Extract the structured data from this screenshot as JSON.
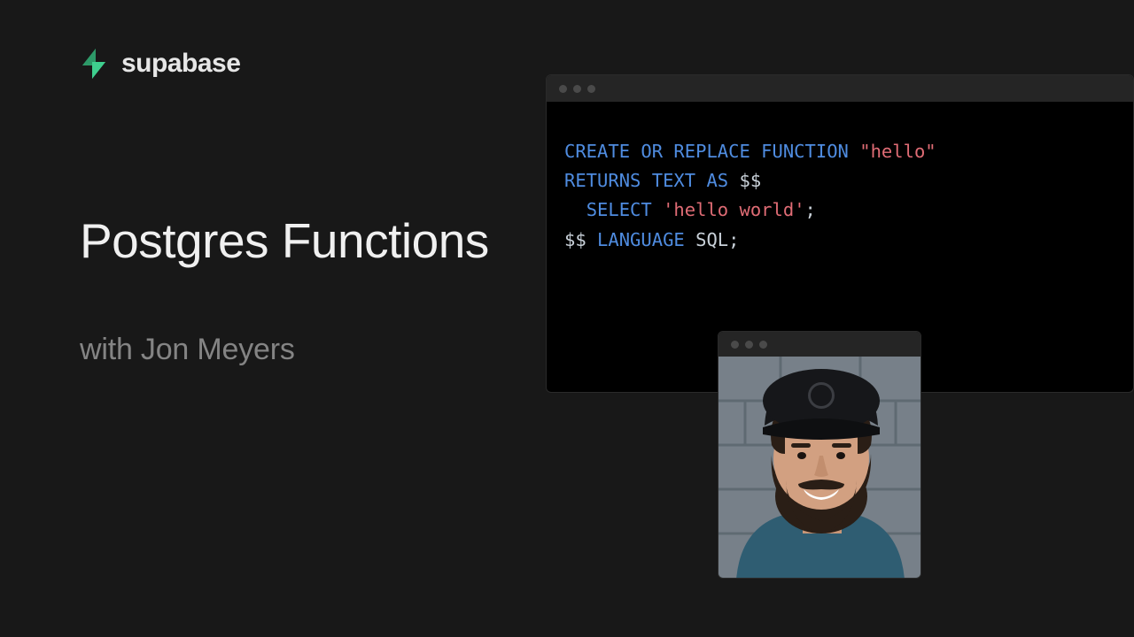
{
  "brand": {
    "name": "supabase",
    "logo_color": "#3ecf8e"
  },
  "title": "Postgres Functions",
  "subtitle": "with Jon Meyers",
  "code": {
    "tokens": [
      [
        {
          "c": "tok-kw",
          "t": "CREATE OR REPLACE FUNCTION"
        },
        {
          "c": "tok-punc",
          "t": " "
        },
        {
          "c": "tok-str",
          "t": "\"hello\""
        }
      ],
      [
        {
          "c": "tok-kw",
          "t": "RETURNS TEXT AS"
        },
        {
          "c": "tok-punc",
          "t": " "
        },
        {
          "c": "tok-dol",
          "t": "$$"
        }
      ],
      [
        {
          "c": "tok-punc",
          "t": "  "
        },
        {
          "c": "tok-kw",
          "t": "SELECT"
        },
        {
          "c": "tok-punc",
          "t": " "
        },
        {
          "c": "tok-str",
          "t": "'hello world'"
        },
        {
          "c": "tok-punc",
          "t": ";"
        }
      ],
      [
        {
          "c": "tok-dol",
          "t": "$$"
        },
        {
          "c": "tok-punc",
          "t": " "
        },
        {
          "c": "tok-kw",
          "t": "LANGUAGE"
        },
        {
          "c": "tok-punc",
          "t": " SQL;"
        }
      ]
    ]
  },
  "presenter": {
    "name": "Jon Meyers"
  }
}
